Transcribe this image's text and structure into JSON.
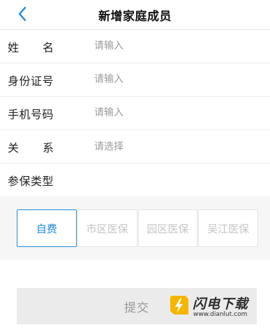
{
  "header": {
    "title": "新增家庭成员",
    "back_icon": "chevron-left-icon",
    "accent": "#1e88d8"
  },
  "form": {
    "name": {
      "label_chars": [
        "姓",
        "名"
      ],
      "placeholder": "请输入"
    },
    "id_number": {
      "label": "身份证号",
      "placeholder": "请输入"
    },
    "phone": {
      "label": "手机号码",
      "placeholder": "请输入"
    },
    "relation": {
      "label_chars": [
        "关",
        "系"
      ],
      "placeholder": "请选择"
    },
    "insurance_type": {
      "label": "参保类型"
    }
  },
  "insurance_options": [
    {
      "label": "自费",
      "selected": true
    },
    {
      "label": "市区医保",
      "selected": false
    },
    {
      "label": "园区医保",
      "selected": false
    },
    {
      "label": "吴江医保",
      "selected": false
    }
  ],
  "submit": {
    "label": "提交"
  },
  "watermark": {
    "brand": "闪电下载",
    "url": "www.dianlut.com",
    "logo_icon": "lightning-logo-icon",
    "logo_color": "#f5b500"
  }
}
